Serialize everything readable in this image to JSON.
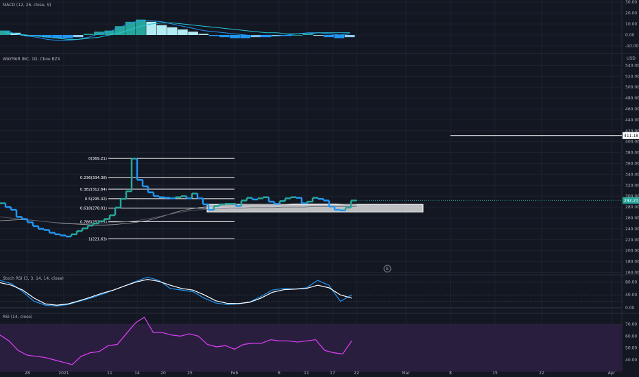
{
  "colors": {
    "background": "#131722",
    "grid": "#1e222d",
    "up": "#26a69a",
    "down": "#2196f3",
    "macd_line": "#2196f3",
    "signal_line": "#26c6da",
    "hist_pos_light": "#b2ebf2",
    "hist_pos_dark": "#26a69a",
    "stoch_k": "#2196f3",
    "stoch_d": "#ffffff",
    "rsi_line": "#e040fb",
    "rsi_band": "#2a1e3f",
    "price_label_bg": "#26a69a",
    "fib_line": "#ffffff"
  },
  "macd": {
    "title": "MACD (12, 26, close, 9)",
    "ticks": [
      "30.00",
      "20.00",
      "10.00",
      "0.00",
      "-10.00"
    ]
  },
  "main": {
    "title": "WAYFAIR INC, 1D, Cboe BZX",
    "currency": "USD",
    "ticks": [
      "540.00",
      "520.00",
      "500.00",
      "480.00",
      "460.00",
      "440.00",
      "420.00",
      "400.00",
      "380.00",
      "360.00",
      "340.00",
      "320.00",
      "300.00",
      "280.00",
      "260.00",
      "240.00",
      "220.00",
      "200.00",
      "180.00",
      "160.00"
    ],
    "horizontal_line_label": "411.18",
    "last_price_label": "292.21",
    "event_marker": "E"
  },
  "fib_levels": [
    {
      "label": "0(369.21)",
      "price": 369.21
    },
    {
      "label": "0.236(334.38)",
      "price": 334.38
    },
    {
      "label": "0.382(312.84)",
      "price": 312.84
    },
    {
      "label": "0.5(295.42)",
      "price": 295.42
    },
    {
      "label": "0.618(278.01)",
      "price": 278.01
    },
    {
      "label": "0.786(253.21)",
      "price": 253.21
    },
    {
      "label": "1(221.63)",
      "price": 221.63
    }
  ],
  "stoch": {
    "title": "Stoch RSI (3, 3, 14, 14, close)",
    "ticks": [
      "80.00",
      "40.00",
      "0.00"
    ]
  },
  "rsi": {
    "title": "RSI (14, close)",
    "ticks": [
      "70.00",
      "60.00",
      "50.00",
      "40.00"
    ]
  },
  "xaxis": {
    "ticks": [
      "28",
      "2021",
      "11",
      "14",
      "20",
      "25",
      "Feb",
      "8",
      "11",
      "17",
      "22",
      "Mar",
      "8",
      "15",
      "22",
      "Apr"
    ]
  },
  "chart_data": {
    "type": "line",
    "title": "WAYFAIR INC, 1D, Cboe BZX",
    "price_step_close": [
      287,
      280,
      275,
      262,
      258,
      252,
      245,
      240,
      238,
      233,
      230,
      228,
      226,
      230,
      236,
      241,
      246,
      250,
      254,
      258,
      265,
      279,
      295,
      309,
      369,
      330,
      318,
      307,
      300,
      298,
      297,
      296,
      298,
      300,
      296,
      305,
      296,
      285,
      275,
      282,
      285,
      286,
      286,
      282,
      292,
      297,
      294,
      296,
      298,
      290,
      286,
      291,
      296,
      298,
      297,
      287,
      290,
      297,
      295,
      292,
      281,
      275,
      274,
      279,
      292
    ],
    "horizontal_line": 411.18,
    "last_price": 292.21,
    "zone": [
      271,
      285
    ],
    "rsi": [
      61,
      56,
      48,
      44,
      43,
      42,
      40,
      38,
      36,
      43,
      46,
      47,
      52,
      53,
      62,
      71,
      76,
      63,
      63,
      61,
      60,
      62,
      60,
      53,
      51,
      52,
      49,
      53,
      54,
      54,
      57,
      56,
      56,
      55,
      56,
      57,
      48,
      46,
      45,
      56
    ],
    "stoch_k": [
      85,
      75,
      50,
      20,
      8,
      5,
      10,
      20,
      30,
      42,
      55,
      68,
      82,
      95,
      85,
      60,
      55,
      50,
      30,
      15,
      10,
      12,
      18,
      35,
      55,
      60,
      58,
      62,
      85,
      70,
      20,
      40
    ],
    "stoch_d": [
      78,
      70,
      55,
      30,
      12,
      8,
      12,
      22,
      33,
      45,
      55,
      68,
      80,
      88,
      82,
      70,
      60,
      55,
      40,
      22,
      14,
      13,
      17,
      30,
      48,
      56,
      58,
      60,
      70,
      62,
      40,
      30
    ],
    "macd_hist": [
      4,
      2,
      0,
      -1,
      -2,
      -3,
      -3,
      -2,
      1,
      3,
      4,
      8,
      12,
      14,
      12,
      9,
      7,
      5,
      3,
      1,
      -1,
      -2,
      -3,
      -3,
      -2,
      -2,
      -1,
      -1,
      0,
      1,
      0,
      -2,
      -3,
      -2
    ],
    "macd_line": [
      4,
      1,
      -1,
      -2,
      -4,
      -5,
      -5,
      -4,
      -2,
      1,
      3,
      7,
      11,
      13,
      13,
      12,
      10,
      8,
      6,
      4,
      3,
      2,
      1,
      0,
      -1,
      -1,
      -1,
      0,
      1,
      2,
      2,
      1,
      0,
      1
    ],
    "signal_line": [
      2,
      1,
      0,
      -1,
      -2,
      -3,
      -4,
      -4,
      -3,
      -2,
      0,
      2,
      5,
      8,
      10,
      11,
      11,
      10,
      9,
      8,
      7,
      6,
      5,
      4,
      3,
      2,
      2,
      1,
      1,
      1,
      2,
      2,
      2,
      2
    ]
  }
}
